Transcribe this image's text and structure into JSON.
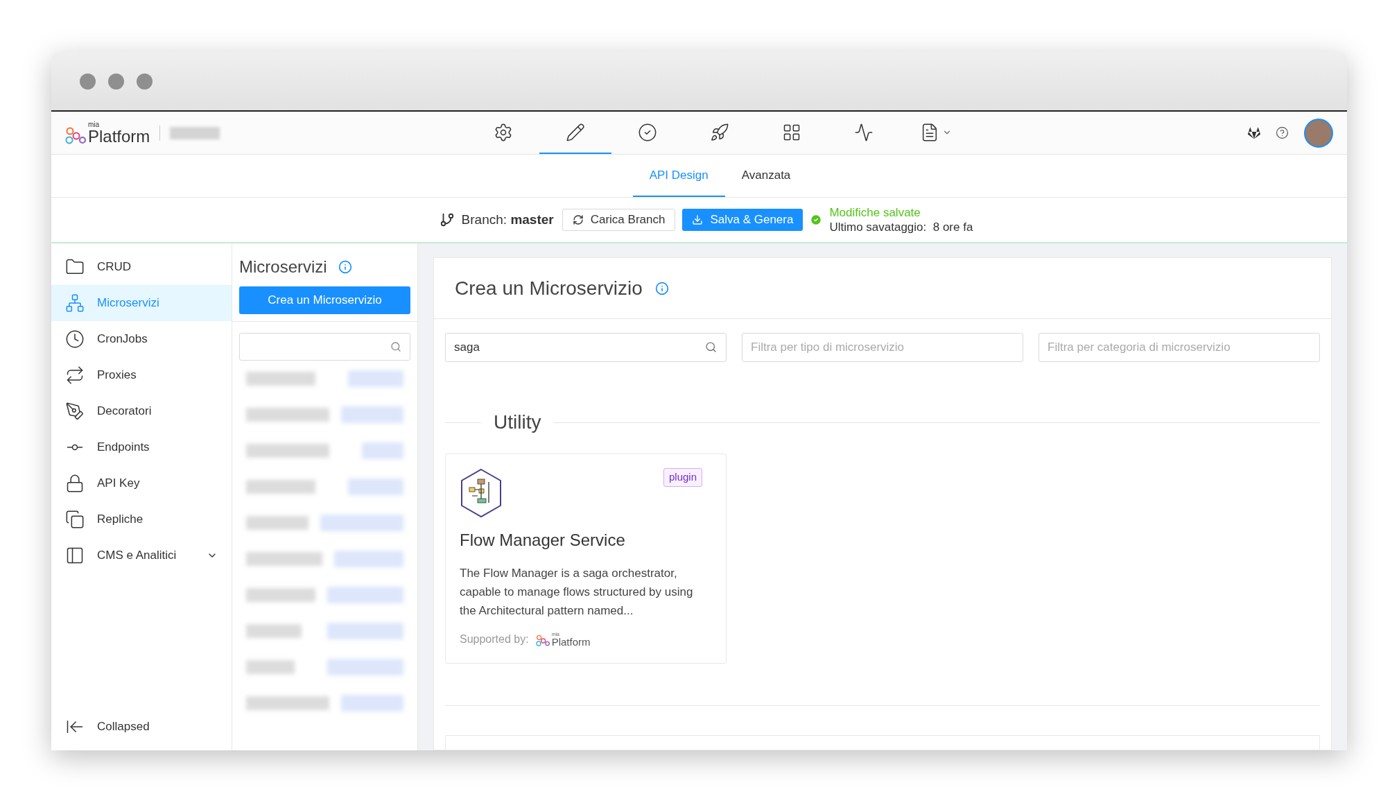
{
  "header": {
    "logo": {
      "small": "mia",
      "name": "Platform"
    },
    "nav": [
      {
        "kind": "settings",
        "selected": false
      },
      {
        "kind": "design",
        "selected": true
      },
      {
        "kind": "check",
        "selected": false
      },
      {
        "kind": "deploy",
        "selected": false
      },
      {
        "kind": "grid",
        "selected": false
      },
      {
        "kind": "monitor",
        "selected": false
      },
      {
        "kind": "docs",
        "selected": false
      }
    ]
  },
  "subtabs": [
    {
      "label": "API Design",
      "selected": true
    },
    {
      "label": "Avanzata",
      "selected": false
    }
  ],
  "branch_bar": {
    "label": "Branch:",
    "branch": "master",
    "load_button": "Carica Branch",
    "save_button": "Salva & Genera",
    "status": "Modifiche salvate",
    "last_saved_label": "Ultimo savataggio:",
    "last_saved_value": "8 ore fa"
  },
  "sidebar": {
    "items": [
      {
        "kind": "crud",
        "label": "CRUD",
        "selected": false,
        "expandable": false
      },
      {
        "kind": "microservices",
        "label": "Microservizi",
        "selected": true,
        "expandable": false
      },
      {
        "kind": "cron",
        "label": "CronJobs",
        "selected": false,
        "expandable": false
      },
      {
        "kind": "proxy",
        "label": "Proxies",
        "selected": false,
        "expandable": false
      },
      {
        "kind": "decorator",
        "label": "Decoratori",
        "selected": false,
        "expandable": false
      },
      {
        "kind": "endpoint",
        "label": "Endpoints",
        "selected": false,
        "expandable": false
      },
      {
        "kind": "apikey",
        "label": "API Key",
        "selected": false,
        "expandable": false
      },
      {
        "kind": "replicas",
        "label": "Repliche",
        "selected": false,
        "expandable": false
      },
      {
        "kind": "cms",
        "label": "CMS e Analitici",
        "selected": false,
        "expandable": true
      }
    ],
    "collapse": "Collapsed"
  },
  "list_panel": {
    "title": "Microservizi",
    "create_button": "Crea un Microservizio"
  },
  "main": {
    "title": "Crea un Microservizio",
    "search": {
      "value": "saga"
    },
    "filters": [
      {
        "placeholder": "Filtra per tipo di microservizio"
      },
      {
        "placeholder": "Filtra per categoria di microservizio"
      }
    ],
    "section": "Utility",
    "cards": [
      {
        "title": "Flow Manager Service",
        "badge": "plugin",
        "description": "The Flow Manager is a saga orchestrator, capable to manage flows structured by using the Architectural pattern named...",
        "supported_label": "Supported by:",
        "supporter": {
          "small": "mia",
          "name": "Platform"
        }
      }
    ]
  }
}
